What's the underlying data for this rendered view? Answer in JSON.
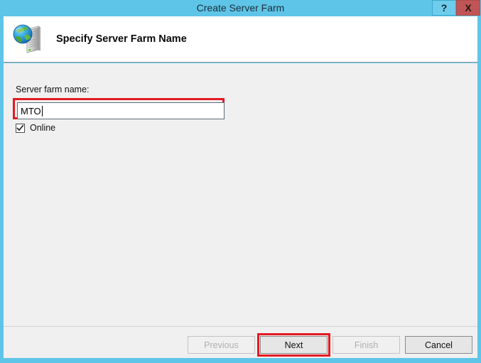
{
  "window": {
    "title": "Create Server Farm",
    "titlebar_buttons": [
      {
        "name": "help",
        "label": "?"
      },
      {
        "name": "close",
        "label": "X"
      }
    ],
    "colors": {
      "titlebar": "#5fc5e8",
      "body": "#f0f0f0",
      "header": "#ffffff",
      "highlight": "#e31b23",
      "close_button": "#c15555"
    }
  },
  "header": {
    "icon": "web-server-icon",
    "heading": "Specify Server Farm Name"
  },
  "form": {
    "field_label": "Server farm name:",
    "farm_name_value": "MTO",
    "farm_name_placeholder": "",
    "online_checkbox": {
      "label": "Online",
      "checked": true
    }
  },
  "footer": {
    "buttons": [
      {
        "name": "previous",
        "label": "Previous",
        "enabled": false,
        "highlighted": false
      },
      {
        "name": "next",
        "label": "Next",
        "enabled": true,
        "highlighted": true
      },
      {
        "name": "finish",
        "label": "Finish",
        "enabled": false,
        "highlighted": false
      },
      {
        "name": "cancel",
        "label": "Cancel",
        "enabled": true,
        "highlighted": false
      }
    ]
  }
}
